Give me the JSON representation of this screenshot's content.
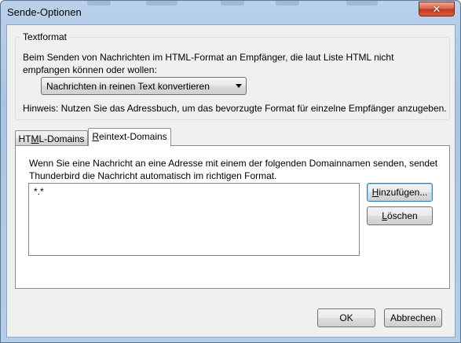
{
  "window": {
    "title": "Sende-Optionen",
    "close_glyph": "✕"
  },
  "text_format": {
    "legend": "Textformat",
    "description": "Beim Senden von Nachrichten im HTML-Format an Empfänger, die laut Liste HTML nicht empfangen können oder wollen:",
    "dropdown_value": "Nachrichten in reinen Text konvertieren",
    "hint": "Hinweis: Nutzen Sie das Adressbuch, um das bevorzugte Format für einzelne Empfänger anzugeben."
  },
  "tabs": [
    {
      "label_pre": "HT",
      "label_key": "M",
      "label_post": "L-Domains",
      "active": false
    },
    {
      "label_pre": "",
      "label_key": "R",
      "label_post": "eintext-Domains",
      "active": true
    }
  ],
  "domain_panel": {
    "description": "Wenn Sie eine Nachricht an eine Adresse mit einem der folgenden Domainnamen senden, sendet Thunderbird die Nachricht automatisch im richtigen Format.",
    "domains": [
      "*.*"
    ],
    "add_button": {
      "pre": "",
      "key": "H",
      "post": "inzufügen..."
    },
    "delete_button": {
      "pre": "",
      "key": "L",
      "post": "öschen"
    }
  },
  "footer": {
    "ok_label": "OK",
    "cancel_label": "Abbrechen"
  },
  "colors": {
    "title_bar": "#b9d1ea",
    "close_button": "#c0391f",
    "dialog_background": "#f0f0f0"
  }
}
